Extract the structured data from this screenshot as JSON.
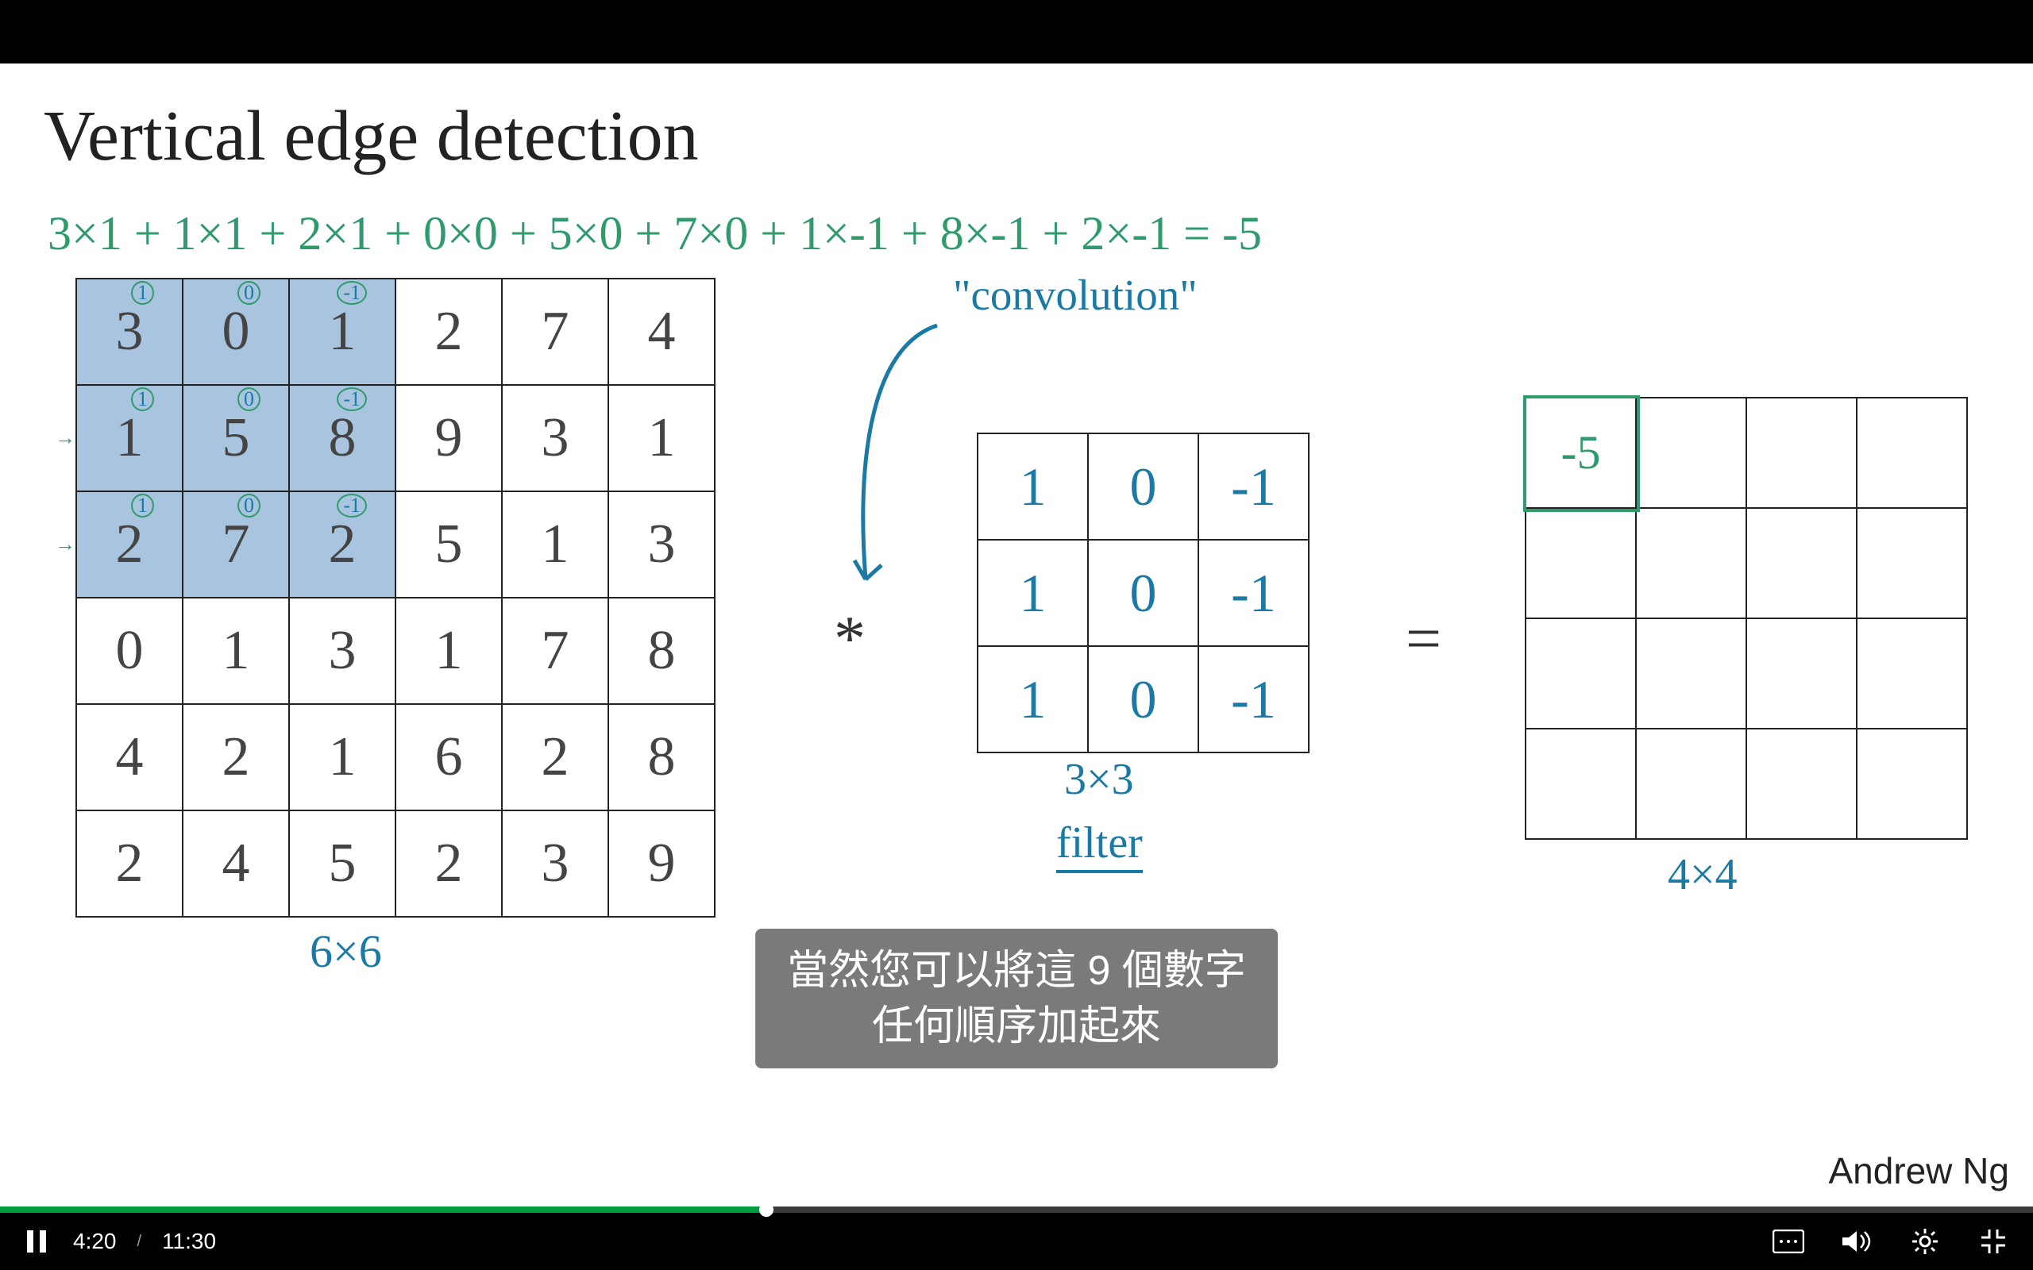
{
  "slide": {
    "title": "Vertical edge detection",
    "equation": "3×1 + 1×1 + 2×1 + 0×0 + 5×0 + 7×0 + 1×-1 + 8×-1 + 2×-1 = -5",
    "input_label": "6×6",
    "filter_size": "3×3",
    "filter_label": "filter",
    "output_label": "4×4",
    "star": "*",
    "equals": "=",
    "conv_label": "\"convolution\"",
    "author": "Andrew Ng",
    "input_matrix": [
      [
        3,
        0,
        1,
        2,
        7,
        4
      ],
      [
        1,
        5,
        8,
        9,
        3,
        1
      ],
      [
        2,
        7,
        2,
        5,
        1,
        3
      ],
      [
        0,
        1,
        3,
        1,
        7,
        8
      ],
      [
        4,
        2,
        1,
        6,
        2,
        8
      ],
      [
        2,
        4,
        5,
        2,
        3,
        9
      ]
    ],
    "superscripts": [
      "1",
      "0",
      "-1"
    ],
    "filter_matrix": [
      [
        1,
        0,
        -1
      ],
      [
        1,
        0,
        -1
      ],
      [
        1,
        0,
        -1
      ]
    ],
    "output_matrix": [
      [
        "-5",
        "",
        "",
        ""
      ],
      [
        "",
        "",
        "",
        ""
      ],
      [
        "",
        "",
        "",
        ""
      ],
      [
        "",
        "",
        "",
        ""
      ]
    ]
  },
  "subtitle": {
    "line1": "當然您可以將這 9 個數字",
    "line2": "任何順序加起來"
  },
  "player": {
    "current": "4:20",
    "sep": "/",
    "total": "11:30",
    "progress_pct": 37.7
  }
}
